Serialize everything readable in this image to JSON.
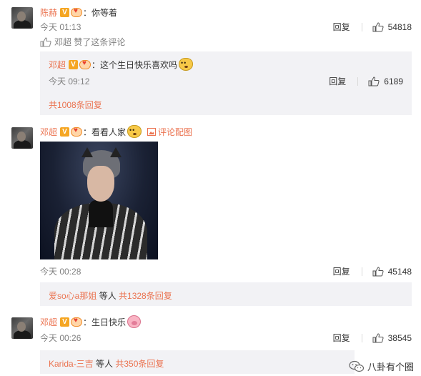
{
  "comments": [
    {
      "user": "陈赫",
      "text": "：你等着",
      "time": "今天 01:13",
      "reply_label": "回复",
      "likes": "54818",
      "liked_by": "邓超 赞了这条评论",
      "reply": {
        "user": "邓超",
        "text": "：这个生日快乐喜欢吗",
        "time": "今天 09:12",
        "reply_label": "回复",
        "likes": "6189",
        "more": "共1008条回复"
      }
    },
    {
      "user": "邓超",
      "text": "：看看人家",
      "image_link": "评论配图",
      "time": "今天 00:28",
      "reply_label": "回复",
      "likes": "45148",
      "replies_summary": {
        "name": "爱so心a那姐",
        "middle": " 等人 ",
        "count": "共1328条回复"
      }
    },
    {
      "user": "邓超",
      "text": "：生日快乐",
      "time": "今天 00:26",
      "reply_label": "回复",
      "likes": "38545",
      "replies_summary": {
        "name": "Karida-三吉",
        "middle": " 等人 ",
        "count": "共350条回复"
      }
    }
  ],
  "watermark": "八卦有个圈",
  "colors": {
    "accent": "#eb7350",
    "panel": "#f2f2f5",
    "muted": "#808080"
  }
}
